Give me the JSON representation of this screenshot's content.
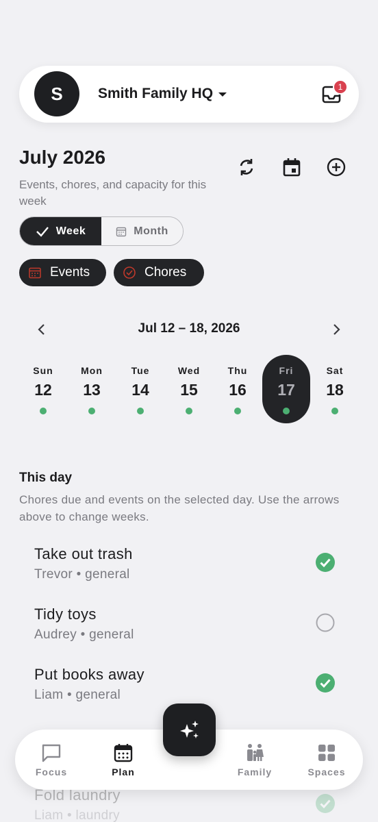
{
  "header": {
    "avatar_initial": "S",
    "family_name": "Smith Family HQ",
    "inbox_badge": "1"
  },
  "page": {
    "title": "July 2026",
    "subtitle": "Events, chores, and capacity for this week"
  },
  "view_toggle": {
    "week_label": "Week",
    "month_label": "Month",
    "selected": "Week"
  },
  "filters": [
    {
      "label": "Events",
      "icon": "calendar-icon"
    },
    {
      "label": "Chores",
      "icon": "check-circle-icon"
    }
  ],
  "week": {
    "range_label": "Jul 12 – 18, 2026",
    "days": [
      {
        "name": "Sun",
        "num": "12",
        "has_items": true
      },
      {
        "name": "Mon",
        "num": "13",
        "has_items": true
      },
      {
        "name": "Tue",
        "num": "14",
        "has_items": true
      },
      {
        "name": "Wed",
        "num": "15",
        "has_items": true
      },
      {
        "name": "Thu",
        "num": "16",
        "has_items": true
      },
      {
        "name": "Fri",
        "num": "17",
        "has_items": true,
        "selected": true
      },
      {
        "name": "Sat",
        "num": "18",
        "has_items": true
      }
    ]
  },
  "this_day": {
    "title": "This day",
    "description": "Chores due and events on the selected day. Use the arrows above to change weeks.",
    "chores": [
      {
        "title": "Take out trash",
        "meta": "Trevor • general",
        "done": true
      },
      {
        "title": "Tidy toys",
        "meta": "Audrey • general",
        "done": false
      },
      {
        "title": "Put books away",
        "meta": "Liam • general",
        "done": true
      },
      {
        "title": "Fold laundry",
        "meta": "Liam • laundry",
        "done": true
      }
    ]
  },
  "bottom_nav": {
    "items": [
      {
        "label": "Focus",
        "icon": "chat-bubble-icon"
      },
      {
        "label": "Plan",
        "icon": "calendar-icon",
        "active": true
      },
      {
        "label": "Family",
        "icon": "family-icon"
      },
      {
        "label": "Spaces",
        "icon": "grid-icon"
      }
    ]
  },
  "colors": {
    "accent_dark": "#232427",
    "success": "#4caf72",
    "badge": "#d9414f",
    "background": "#f1f1f4"
  }
}
